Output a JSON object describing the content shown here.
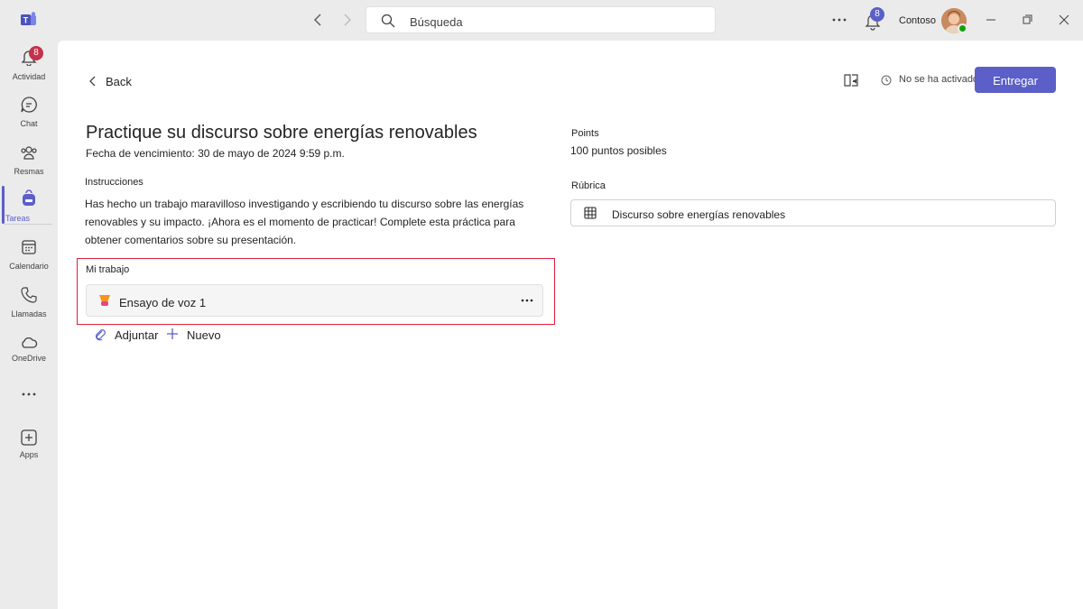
{
  "titlebar": {
    "search_placeholder": "Búsqueda",
    "notification_count": "8",
    "org_name": "Contoso",
    "icons": [
      "teams-logo-icon",
      "chevron-left-icon",
      "chevron-right-icon",
      "search-icon",
      "more-icon",
      "bell-icon",
      "minimize-icon",
      "maximize-icon",
      "close-icon"
    ]
  },
  "rail": {
    "items": [
      {
        "label": "Actividad",
        "icon": "bell-icon",
        "badge": "8"
      },
      {
        "label": "Chat",
        "icon": "chat-icon"
      },
      {
        "label": "Resmas",
        "icon": "teams-icon"
      },
      {
        "label": "Tareas",
        "icon": "backpack-icon",
        "active": true
      },
      {
        "label": "Calendario",
        "icon": "calendar-icon"
      },
      {
        "label": "Llamadas",
        "icon": "phone-icon"
      },
      {
        "label": "OneDrive",
        "icon": "cloud-icon"
      },
      {
        "label": "Apps",
        "icon": "add-app-icon"
      }
    ]
  },
  "header": {
    "back_label": "Back",
    "status_text": "No se ha activado",
    "submit_label": "Entregar"
  },
  "assignment": {
    "title": "Practique su discurso sobre energías renovables",
    "due": "Fecha de vencimiento: 30 de mayo de 2024 9:59 p.m.",
    "instructions_label": "Instrucciones",
    "instructions_text": "Has hecho un trabajo maravilloso investigando y escribiendo tu discurso sobre las energías renovables y su impacto. ¡Ahora es el momento de practicar! Complete esta práctica para obtener comentarios sobre su presentación."
  },
  "my_work": {
    "label": "Mi trabajo",
    "items": [
      {
        "name": "Ensayo de voz 1",
        "icon": "speech-icon"
      }
    ],
    "attach_label": "Adjuntar",
    "new_label": "Nuevo"
  },
  "sidebar": {
    "points_label": "Points",
    "points_value": "100 puntos posibles",
    "rubric_label": "Rúbrica",
    "rubric_name": "Discurso sobre energías renovables"
  },
  "colors": {
    "accent": "#5b5fc7",
    "highlight_border": "#e01e37",
    "badge_red": "#c4314b"
  }
}
